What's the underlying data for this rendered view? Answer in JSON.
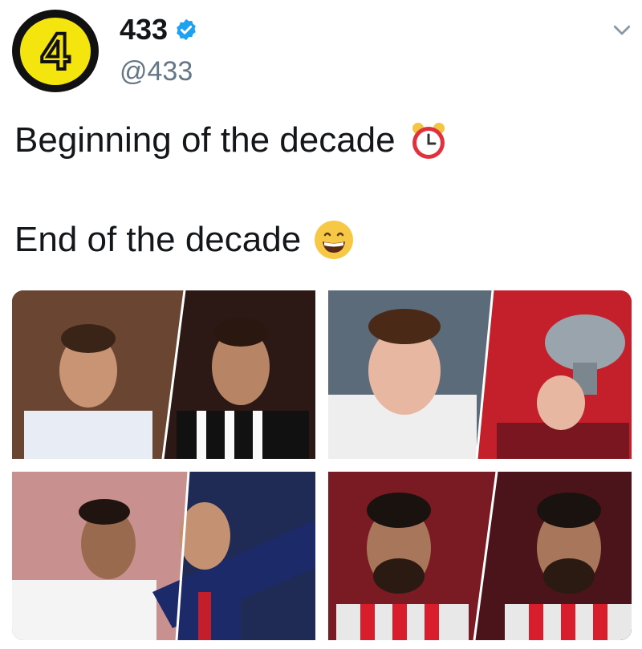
{
  "tweet": {
    "author": {
      "avatar_glyph": "4",
      "display_name": "433",
      "handle": "@433",
      "verified": true
    },
    "line1": "Beginning of the decade",
    "line1_emoji": "alarm-clock-emoji",
    "line2": "End of the decade",
    "line2_emoji": "grinning-face-emoji",
    "menu_icon": "chevron-down-icon"
  },
  "media": {
    "photos": [
      {
        "subject": "then-and-now photo 1",
        "colors": {
          "left": "#5a3a2a",
          "right": "#2a1a18"
        }
      },
      {
        "subject": "then-and-now photo 2",
        "colors": {
          "left": "#6a7a8a",
          "right": "#c41e2a"
        }
      },
      {
        "subject": "then-and-now photo 3",
        "colors": {
          "left": "#c98a8a",
          "right": "#1e2a55"
        }
      },
      {
        "subject": "then-and-now photo 4",
        "colors": {
          "left": "#7a1a22",
          "right": "#5a1820"
        }
      }
    ]
  },
  "colors": {
    "verified": "#1da1f2",
    "text": "#14171a",
    "secondary": "#657786",
    "avatar_yellow": "#f5e50f"
  }
}
